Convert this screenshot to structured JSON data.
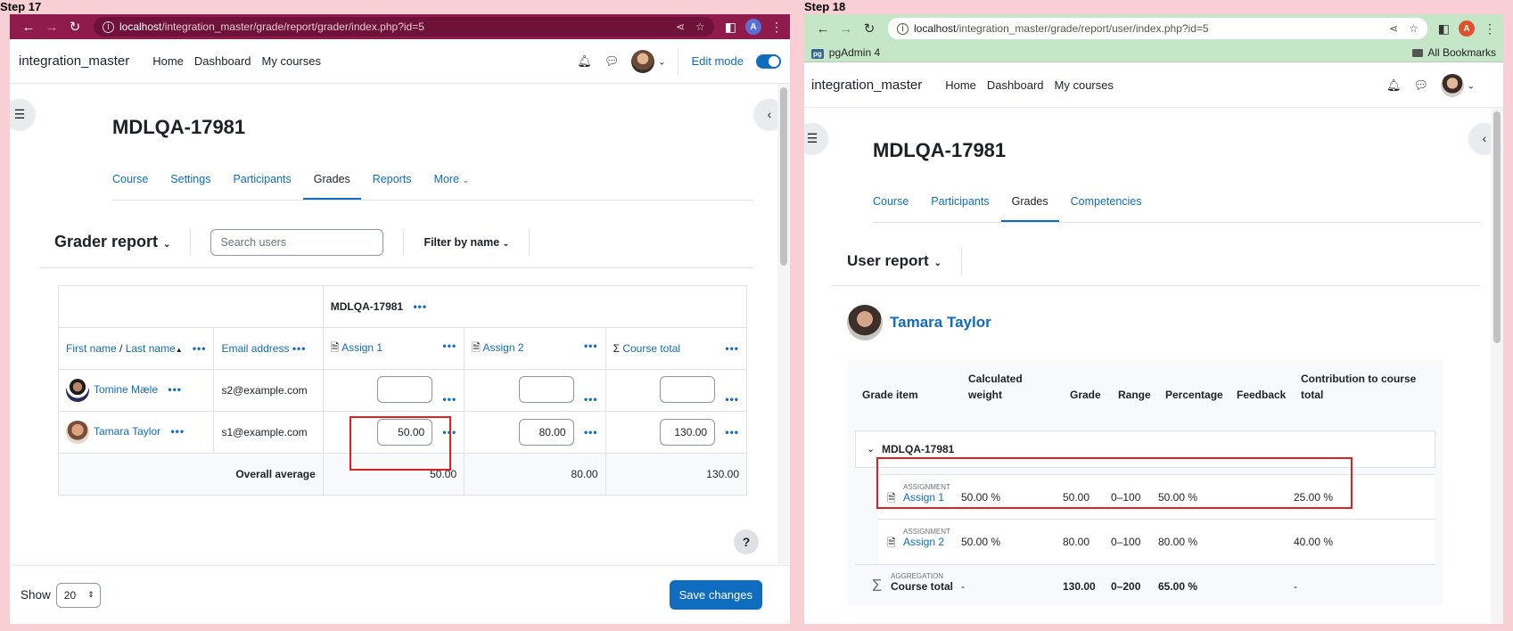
{
  "step17": {
    "label": "Step 17"
  },
  "step18": {
    "label": "Step 18"
  },
  "left": {
    "url": {
      "host": "localhost",
      "path": "/integration_master/grade/report/grader/index.php?id=5"
    },
    "profile_letter": "A",
    "nav": {
      "brand": "integration_master",
      "links": [
        "Home",
        "Dashboard",
        "My courses"
      ],
      "edit_mode": "Edit mode"
    },
    "course_title": "MDLQA-17981",
    "tabs": [
      "Course",
      "Settings",
      "Participants",
      "Grades",
      "Reports",
      "More"
    ],
    "report": {
      "title": "Grader report",
      "search_placeholder": "Search users",
      "filter": "Filter by name"
    },
    "table": {
      "category": "MDLQA-17981",
      "headers": {
        "first": "First name",
        "sep": " / ",
        "last": "Last name",
        "email": "Email address",
        "assign1": "Assign 1",
        "assign2": "Assign 2",
        "total": "Course total"
      },
      "rows": [
        {
          "name": "Tomine Mæle",
          "email": "s2@example.com",
          "a1": "",
          "a2": "",
          "total": ""
        },
        {
          "name": "Tamara Taylor",
          "email": "s1@example.com",
          "a1": "50.00",
          "a2": "80.00",
          "total": "130.00"
        }
      ],
      "avg": {
        "label": "Overall average",
        "a1": "50.00",
        "a2": "80.00",
        "total": "130.00"
      }
    },
    "footer": {
      "show": "Show",
      "per_page": "20",
      "save": "Save changes"
    },
    "help": "?"
  },
  "right": {
    "url": {
      "host": "localhost",
      "path": "/integration_master/grade/report/user/index.php?id=5"
    },
    "profile_letter": "A",
    "bookmarks": {
      "pgadmin": "pgAdmin 4",
      "pg_badge": "pg",
      "all": "All Bookmarks"
    },
    "nav": {
      "brand": "integration_master",
      "links": [
        "Home",
        "Dashboard",
        "My courses"
      ]
    },
    "course_title": "MDLQA-17981",
    "tabs": [
      "Course",
      "Participants",
      "Grades",
      "Competencies"
    ],
    "report": {
      "title": "User report"
    },
    "user": "Tamara Taylor",
    "table": {
      "headers": {
        "item": "Grade item",
        "weight_1": "Calculated",
        "weight_2": "weight",
        "grade": "Grade",
        "range": "Range",
        "pct": "Percentage",
        "feedback": "Feedback",
        "contrib_1": "Contribution to course",
        "contrib_2": "total"
      },
      "category": "MDLQA-17981",
      "rows": [
        {
          "type": "ASSIGNMENT",
          "name": "Assign 1",
          "weight": "50.00 %",
          "grade": "50.00",
          "range": "0–100",
          "pct": "50.00 %",
          "contrib": "25.00 %"
        },
        {
          "type": "ASSIGNMENT",
          "name": "Assign 2",
          "weight": "50.00 %",
          "grade": "80.00",
          "range": "0–100",
          "pct": "80.00 %",
          "contrib": "40.00 %"
        },
        {
          "type": "AGGREGATION",
          "name": "Course total",
          "weight": "-",
          "grade": "130.00",
          "range": "0–200",
          "pct": "65.00 %",
          "contrib": "-"
        }
      ]
    }
  }
}
